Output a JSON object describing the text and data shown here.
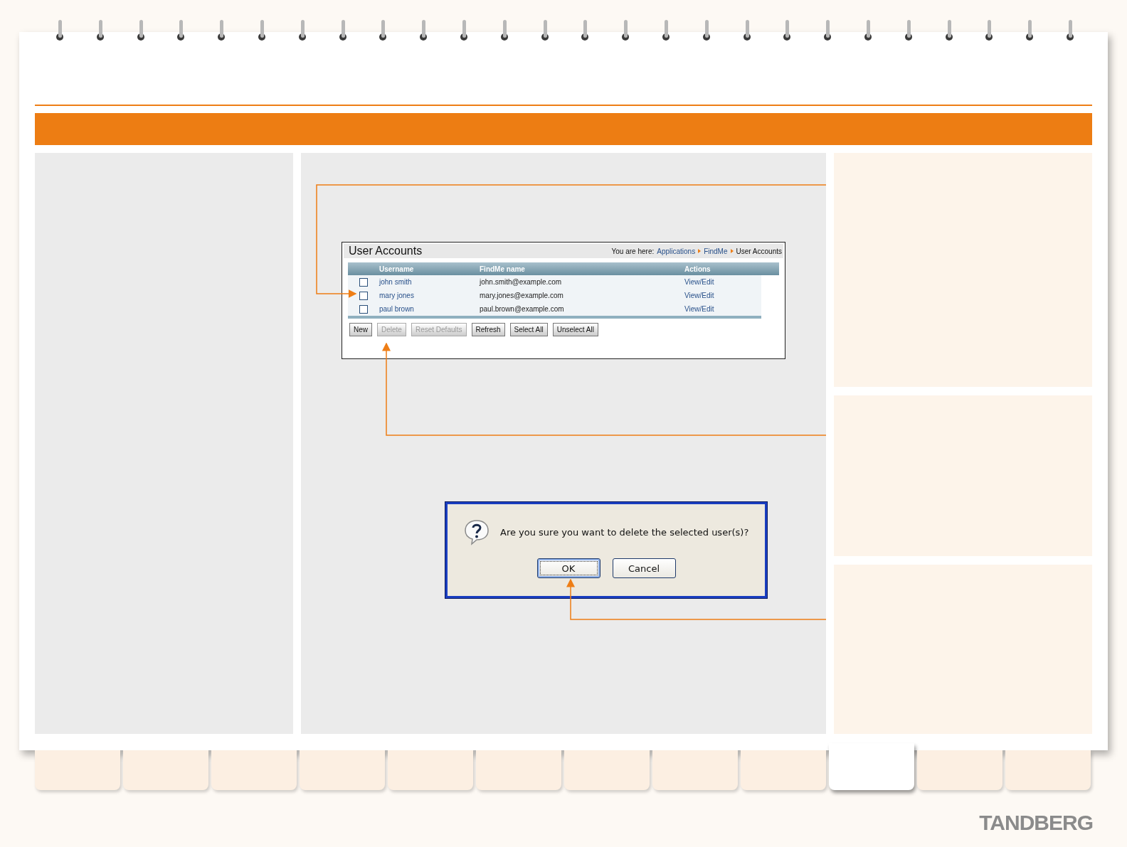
{
  "screenshot": {
    "title": "User Accounts",
    "breadcrumb_label": "You are here:",
    "breadcrumb": [
      {
        "label": "Applications",
        "kind": "link"
      },
      {
        "label": "FindMe",
        "kind": "link"
      },
      {
        "label": "User Accounts",
        "kind": "current"
      }
    ],
    "columns": [
      "Username",
      "FindMe name",
      "Actions"
    ],
    "rows": [
      {
        "username": "john smith",
        "findme": "john.smith@example.com",
        "action": "View/Edit",
        "checked": false
      },
      {
        "username": "mary jones",
        "findme": "mary.jones@example.com",
        "action": "View/Edit",
        "checked": false
      },
      {
        "username": "paul brown",
        "findme": "paul.brown@example.com",
        "action": "View/Edit",
        "checked": false
      }
    ],
    "buttons": [
      {
        "label": "New",
        "disabled": false
      },
      {
        "label": "Delete",
        "disabled": true
      },
      {
        "label": "Reset Defaults",
        "disabled": true
      },
      {
        "label": "Refresh",
        "disabled": false
      },
      {
        "label": "Select All",
        "disabled": false
      },
      {
        "label": "Unselect All",
        "disabled": false
      }
    ]
  },
  "dialog": {
    "message": "Are you sure you want to delete the selected user(s)?",
    "buttons": [
      {
        "label": "OK",
        "focused": true
      },
      {
        "label": "Cancel",
        "focused": false
      }
    ]
  },
  "tabs": [
    {
      "selected": false
    },
    {
      "selected": false
    },
    {
      "selected": false
    },
    {
      "selected": false
    },
    {
      "selected": false
    },
    {
      "selected": false
    },
    {
      "selected": false
    },
    {
      "selected": false
    },
    {
      "selected": false
    },
    {
      "selected": true
    },
    {
      "selected": false
    },
    {
      "selected": false
    }
  ],
  "logo": "TANDBERG"
}
